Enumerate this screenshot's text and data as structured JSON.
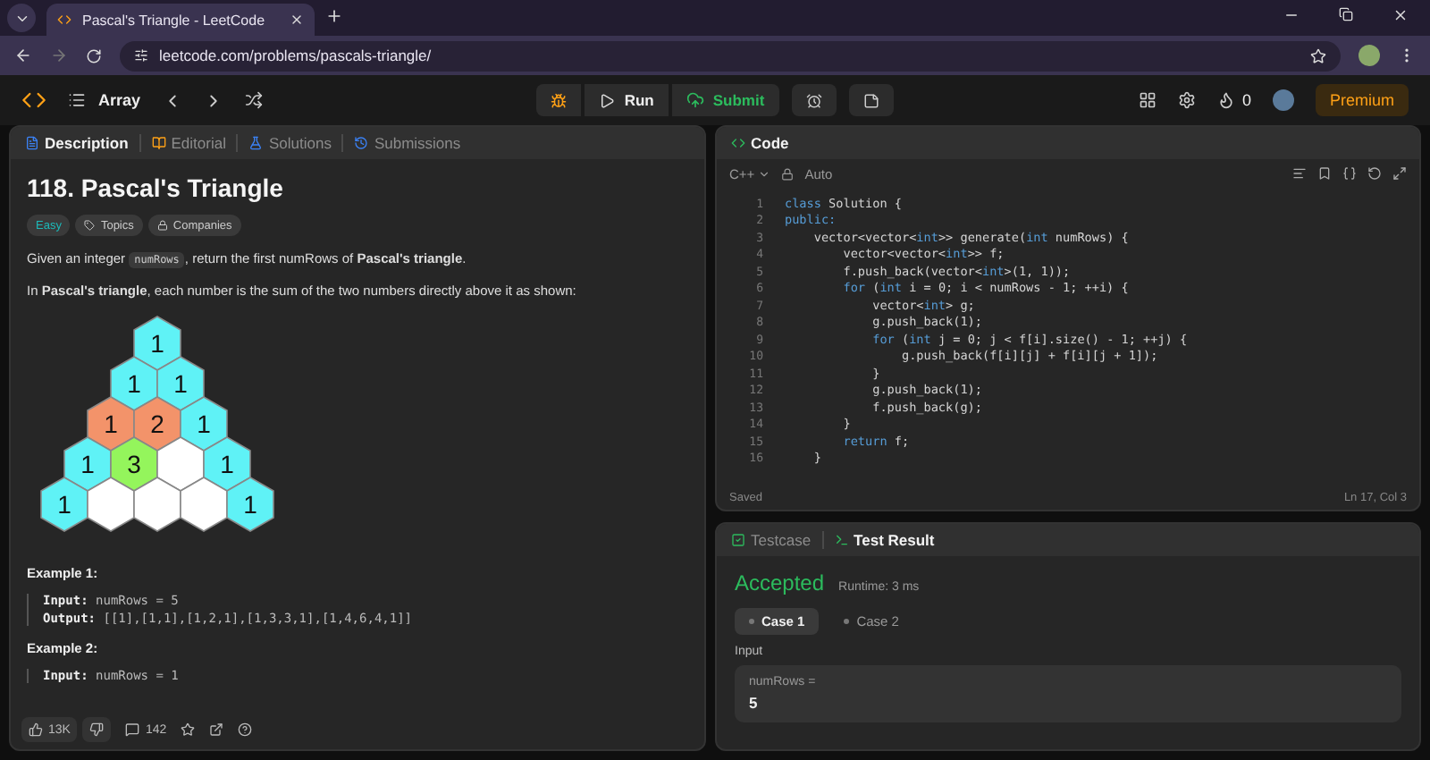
{
  "browser": {
    "tab_title": "Pascal's Triangle - LeetCode",
    "url": "leetcode.com/problems/pascals-triangle/"
  },
  "header": {
    "problem_list": "Array",
    "run": "Run",
    "submit": "Submit",
    "streak": "0",
    "premium": "Premium"
  },
  "description_tabs": [
    {
      "label": "Description",
      "selected": true
    },
    {
      "label": "Editorial",
      "selected": false
    },
    {
      "label": "Solutions",
      "selected": false
    },
    {
      "label": "Submissions",
      "selected": false
    }
  ],
  "problem": {
    "title": "118. Pascal's Triangle",
    "difficulty": "Easy",
    "tags": [
      "Topics",
      "Companies"
    ],
    "paragraphs": [
      [
        {
          "kind": "text",
          "text": "Given an integer "
        },
        {
          "kind": "code",
          "text": "numRows"
        },
        {
          "kind": "text",
          "text": ", return the first numRows of **Pascal's triangle**."
        }
      ],
      [
        {
          "kind": "text",
          "text": "In **Pascal's triangle**, each number is the sum of the two numbers directly above it as shown:"
        }
      ]
    ],
    "triangle": [
      [
        {
          "value": "1",
          "color": "#5ff2f6"
        }
      ],
      [
        {
          "value": "1",
          "color": "#5ff2f6"
        },
        {
          "value": "1",
          "color": "#5ff2f6"
        }
      ],
      [
        {
          "value": "1",
          "color": "#f3936a"
        },
        {
          "value": "2",
          "color": "#f3936a"
        },
        {
          "value": "1",
          "color": "#5ff2f6"
        }
      ],
      [
        {
          "value": "1",
          "color": "#5ff2f6"
        },
        {
          "value": "3",
          "color": "#94f55c"
        },
        {
          "color": "#ffffff"
        },
        {
          "value": "1",
          "color": "#5ff2f6"
        }
      ],
      [
        {
          "value": "1",
          "color": "#5ff2f6"
        },
        {
          "color": "#ffffff"
        },
        {
          "color": "#ffffff"
        },
        {
          "color": "#ffffff"
        },
        {
          "value": "1",
          "color": "#5ff2f6"
        }
      ]
    ],
    "examples": [
      {
        "title": "Example 1:",
        "lines": [
          "**Input:** numRows = 5",
          "**Output:** [[1],[1,1],[1,2,1],[1,3,3,1],[1,4,6,4,1]]"
        ]
      },
      {
        "title": "Example 2:",
        "lines": [
          "**Input:** numRows = 1"
        ]
      }
    ]
  },
  "footer": {
    "likes": "13K",
    "comments": "142"
  },
  "code_panel": {
    "title": "Code",
    "language": "C++",
    "mode": "Auto",
    "lines": [
      {
        "number": "1",
        "tokens": [
          {
            "kind": "kw",
            "text": "class"
          },
          {
            "kind": "plain",
            "text": " Solution {"
          }
        ]
      },
      {
        "number": "2",
        "tokens": [
          {
            "kind": "kw",
            "text": "public:"
          }
        ]
      },
      {
        "number": "3",
        "tokens": [
          {
            "kind": "plain",
            "text": "    vector<vector<"
          },
          {
            "kind": "kw",
            "text": "int"
          },
          {
            "kind": "plain",
            "text": ">> generate("
          },
          {
            "kind": "kw",
            "text": "int"
          },
          {
            "kind": "plain",
            "text": " numRows) {"
          }
        ]
      },
      {
        "number": "4",
        "tokens": [
          {
            "kind": "plain",
            "text": "        vector<vector<"
          },
          {
            "kind": "kw",
            "text": "int"
          },
          {
            "kind": "plain",
            "text": ">> f;"
          }
        ]
      },
      {
        "number": "5",
        "tokens": [
          {
            "kind": "plain",
            "text": "        f.push_back(vector<"
          },
          {
            "kind": "kw",
            "text": "int"
          },
          {
            "kind": "plain",
            "text": ">(1, 1));"
          }
        ]
      },
      {
        "number": "6",
        "tokens": [
          {
            "kind": "kw",
            "text": "        for"
          },
          {
            "kind": "plain",
            "text": " ("
          },
          {
            "kind": "kw",
            "text": "int"
          },
          {
            "kind": "plain",
            "text": " i = 0; i < numRows - 1; ++i) {"
          }
        ]
      },
      {
        "number": "7",
        "tokens": [
          {
            "kind": "plain",
            "text": "            vector<"
          },
          {
            "kind": "kw",
            "text": "int"
          },
          {
            "kind": "plain",
            "text": "> g;"
          }
        ]
      },
      {
        "number": "8",
        "tokens": [
          {
            "kind": "plain",
            "text": "            g.push_back(1);"
          }
        ]
      },
      {
        "number": "9",
        "tokens": [
          {
            "kind": "kw",
            "text": "            for"
          },
          {
            "kind": "plain",
            "text": " ("
          },
          {
            "kind": "kw",
            "text": "int"
          },
          {
            "kind": "plain",
            "text": " j = 0; j < f[i].size() - 1; ++j) {"
          }
        ]
      },
      {
        "number": "10",
        "tokens": [
          {
            "kind": "plain",
            "text": "                g.push_back(f[i][j] + f[i][j + 1]);"
          }
        ]
      },
      {
        "number": "11",
        "tokens": [
          {
            "kind": "plain",
            "text": "            }"
          }
        ]
      },
      {
        "number": "12",
        "tokens": [
          {
            "kind": "plain",
            "text": "            g.push_back(1);"
          }
        ]
      },
      {
        "number": "13",
        "tokens": [
          {
            "kind": "plain",
            "text": "            f.push_back(g);"
          }
        ]
      },
      {
        "number": "14",
        "tokens": [
          {
            "kind": "plain",
            "text": "        }"
          }
        ]
      },
      {
        "number": "15",
        "tokens": [
          {
            "kind": "kw",
            "text": "        return"
          },
          {
            "kind": "plain",
            "text": " f;"
          }
        ]
      },
      {
        "number": "16",
        "tokens": [
          {
            "kind": "plain",
            "text": "    }"
          }
        ]
      }
    ],
    "status": "Saved",
    "cursor": "Ln 17, Col 3"
  },
  "result_tabs": [
    {
      "label": "Testcase",
      "selected": false
    },
    {
      "label": "Test Result",
      "selected": true
    }
  ],
  "result": {
    "verdict": "Accepted",
    "runtime": "Runtime: 3 ms",
    "cases": [
      {
        "label": "Case 1",
        "selected": true
      },
      {
        "label": "Case 2",
        "selected": false
      }
    ],
    "input_label": "Input",
    "param_name": "numRows =",
    "param_value": "5"
  }
}
